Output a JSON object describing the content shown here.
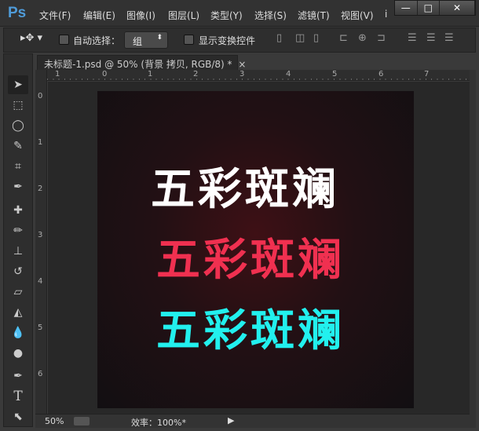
{
  "app": {
    "logo": "Ps",
    "menus": [
      "文件(F)",
      "编辑(E)",
      "图像(I)",
      "图层(L)",
      "类型(Y)",
      "选择(S)",
      "滤镜(T)",
      "视图(V)",
      "i"
    ],
    "window_buttons": [
      "—",
      "□",
      "✕"
    ]
  },
  "options": {
    "auto_select_label": "自动选择：",
    "auto_select_value": "组",
    "show_transform_label": "显示变换控件",
    "align_icons": [
      "align-top-icon",
      "align-vcenter-icon",
      "align-bottom-icon",
      "align-left-icon",
      "align-hcenter-icon",
      "align-right-icon",
      "distribute-top-icon",
      "distribute-vcenter-icon",
      "distribute-bottom-icon"
    ]
  },
  "document": {
    "tab_title": "未标题-1.psd @ 50% (背景 拷贝, RGB/8) *",
    "close": "×",
    "ruler_top": [
      "1",
      "0",
      "1",
      "2",
      "3",
      "4",
      "5",
      "6",
      "7"
    ],
    "ruler_left": [
      "0",
      "1",
      "2",
      "3",
      "4",
      "5",
      "6"
    ],
    "lines": [
      {
        "text": "五彩斑斓",
        "color": "#ffffff"
      },
      {
        "text": "五彩斑斓",
        "color": "#f03050"
      },
      {
        "text": "五彩斑斓",
        "color": "#22f0ee"
      }
    ]
  },
  "status": {
    "zoom": "50%",
    "efficiency": "效率：100%*"
  },
  "tools": [
    "move-tool",
    "marquee-tool",
    "lasso-tool",
    "quick-select-tool",
    "crop-tool",
    "eyedropper-tool",
    "healing-brush-tool",
    "brush-tool",
    "clone-stamp-tool",
    "history-brush-tool",
    "eraser-tool",
    "paint-bucket-tool",
    "blur-tool",
    "dodge-tool",
    "pen-tool",
    "type-tool",
    "path-select-tool"
  ]
}
